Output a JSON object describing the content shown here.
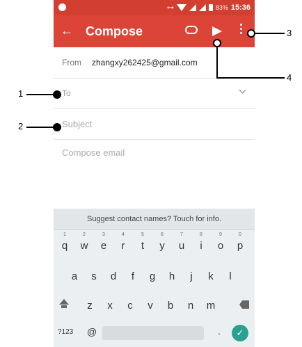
{
  "status_bar": {
    "battery": "83%",
    "time": "15:36"
  },
  "app_bar": {
    "back_icon": "back-arrow-icon",
    "title": "Compose",
    "attach_icon": "paperclip-icon",
    "send_icon": "send-icon",
    "more_icon": "more-vert-icon"
  },
  "compose": {
    "from_label": "From",
    "from_value": "zhangxy262425@gmail.com",
    "to_placeholder": "To",
    "subject_placeholder": "Subject",
    "body_placeholder": "Compose email"
  },
  "keyboard": {
    "suggestion": "Suggest contact names? Touch for info.",
    "row1": [
      "q",
      "w",
      "e",
      "r",
      "t",
      "y",
      "u",
      "i",
      "o",
      "p"
    ],
    "row1_numbers": [
      "1",
      "2",
      "3",
      "4",
      "5",
      "6",
      "7",
      "8",
      "9",
      "0"
    ],
    "row2": [
      "a",
      "s",
      "d",
      "f",
      "g",
      "h",
      "j",
      "k",
      "l"
    ],
    "row3": [
      "z",
      "x",
      "c",
      "v",
      "b",
      "n",
      "m"
    ],
    "sym_key": "?123",
    "at_key": "@",
    "dot_key": "."
  },
  "callouts": [
    "1",
    "2",
    "3",
    "4"
  ]
}
